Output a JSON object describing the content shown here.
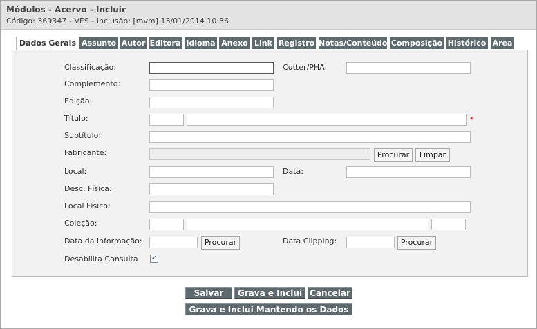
{
  "header": {
    "title": "Módulos - Acervo - Incluir",
    "subtitle": "Código: 369347 - VES - Inclusão: [mvm] 13/01/2014 10:36"
  },
  "tabs": [
    "Dados Gerais",
    "Assunto",
    "Autor",
    "Editora",
    "Idioma",
    "Anexo",
    "Link",
    "Registro",
    "Notas/Conteúdo",
    "Composição",
    "Histórico",
    "Área"
  ],
  "active_tab": "Dados Gerais",
  "form": {
    "classificacao_label": "Classificação:",
    "cutter_label": "Cutter/PHA:",
    "complemento_label": "Complemento:",
    "edicao_label": "Edição:",
    "titulo_label": "Título:",
    "required_mark": "*",
    "subtitulo_label": "Subtítulo:",
    "fabricante_label": "Fabricante:",
    "procurar_label": "Procurar",
    "limpar_label": "Limpar",
    "local_label": "Local:",
    "data_label": "Data:",
    "desc_fisica_label": "Desc. Física:",
    "local_fisico_label": "Local Físico:",
    "colecao_label": "Coleção:",
    "data_informacao_label": "Data da informação:",
    "data_clipping_label": "Data Clipping:",
    "desabilita_label": "Desabilita Consulta",
    "desabilita_checked": true,
    "check_mark": "✓"
  },
  "actions": {
    "salvar": "Salvar",
    "grava_inclui": "Grava e Inclui",
    "cancelar": "Cancelar",
    "grava_mantendo": "Grava e Inclui Mantendo os Dados"
  }
}
